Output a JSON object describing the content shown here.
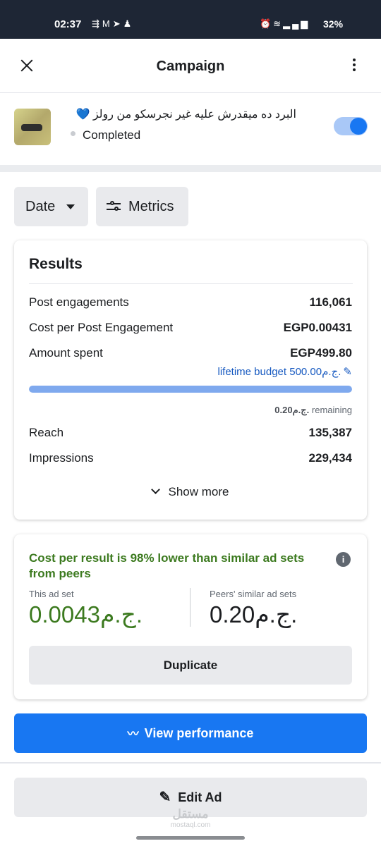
{
  "status_bar": {
    "time": "02:37",
    "left_icons": [
      "cast-icon",
      "m-icon",
      "telegram-icon",
      "ghost-icon"
    ],
    "right_icons": [
      "alarm-icon",
      "wifi-icon",
      "signal-icon",
      "signal-icon"
    ],
    "battery": "32%"
  },
  "header": {
    "title": "Campaign",
    "close_icon": "close-icon",
    "more_icon": "more-vertical-icon"
  },
  "ad": {
    "name": "البرد ده ميقدرش عليه غير نجرسكو من رولز 💙",
    "status": "Completed",
    "toggle_on": true,
    "accent": "#1877f2"
  },
  "filters": {
    "date_label": "Date",
    "metrics_label": "Metrics"
  },
  "results": {
    "title": "Results",
    "rows": [
      {
        "label": "Post engagements",
        "value": "116,061"
      },
      {
        "label": "Cost per Post Engagement",
        "value": "EGP0.00431"
      },
      {
        "label": "Amount spent",
        "value": "EGP499.80"
      }
    ],
    "budget_link": "lifetime budget 500.00ج.م.",
    "budget_progress": 0.9996,
    "remaining_amount": "0.20ج.م.",
    "remaining_label": "remaining",
    "more_rows": [
      {
        "label": "Reach",
        "value": "135,387"
      },
      {
        "label": "Impressions",
        "value": "229,434"
      }
    ],
    "show_more": "Show more"
  },
  "comparison": {
    "headline": "Cost per result is 98% lower than similar ad sets from peers",
    "this_label": "This ad set",
    "this_value": "0.0043ج.م.",
    "peers_label": "Peers' similar ad sets",
    "peers_value": "0.20ج.م.",
    "duplicate_label": "Duplicate",
    "headline_color": "#3c7a1f"
  },
  "actions": {
    "view_performance": "View performance",
    "edit_ad": "Edit Ad"
  },
  "watermark": {
    "arabic": "مستقل",
    "latin": "mostaql.com"
  }
}
